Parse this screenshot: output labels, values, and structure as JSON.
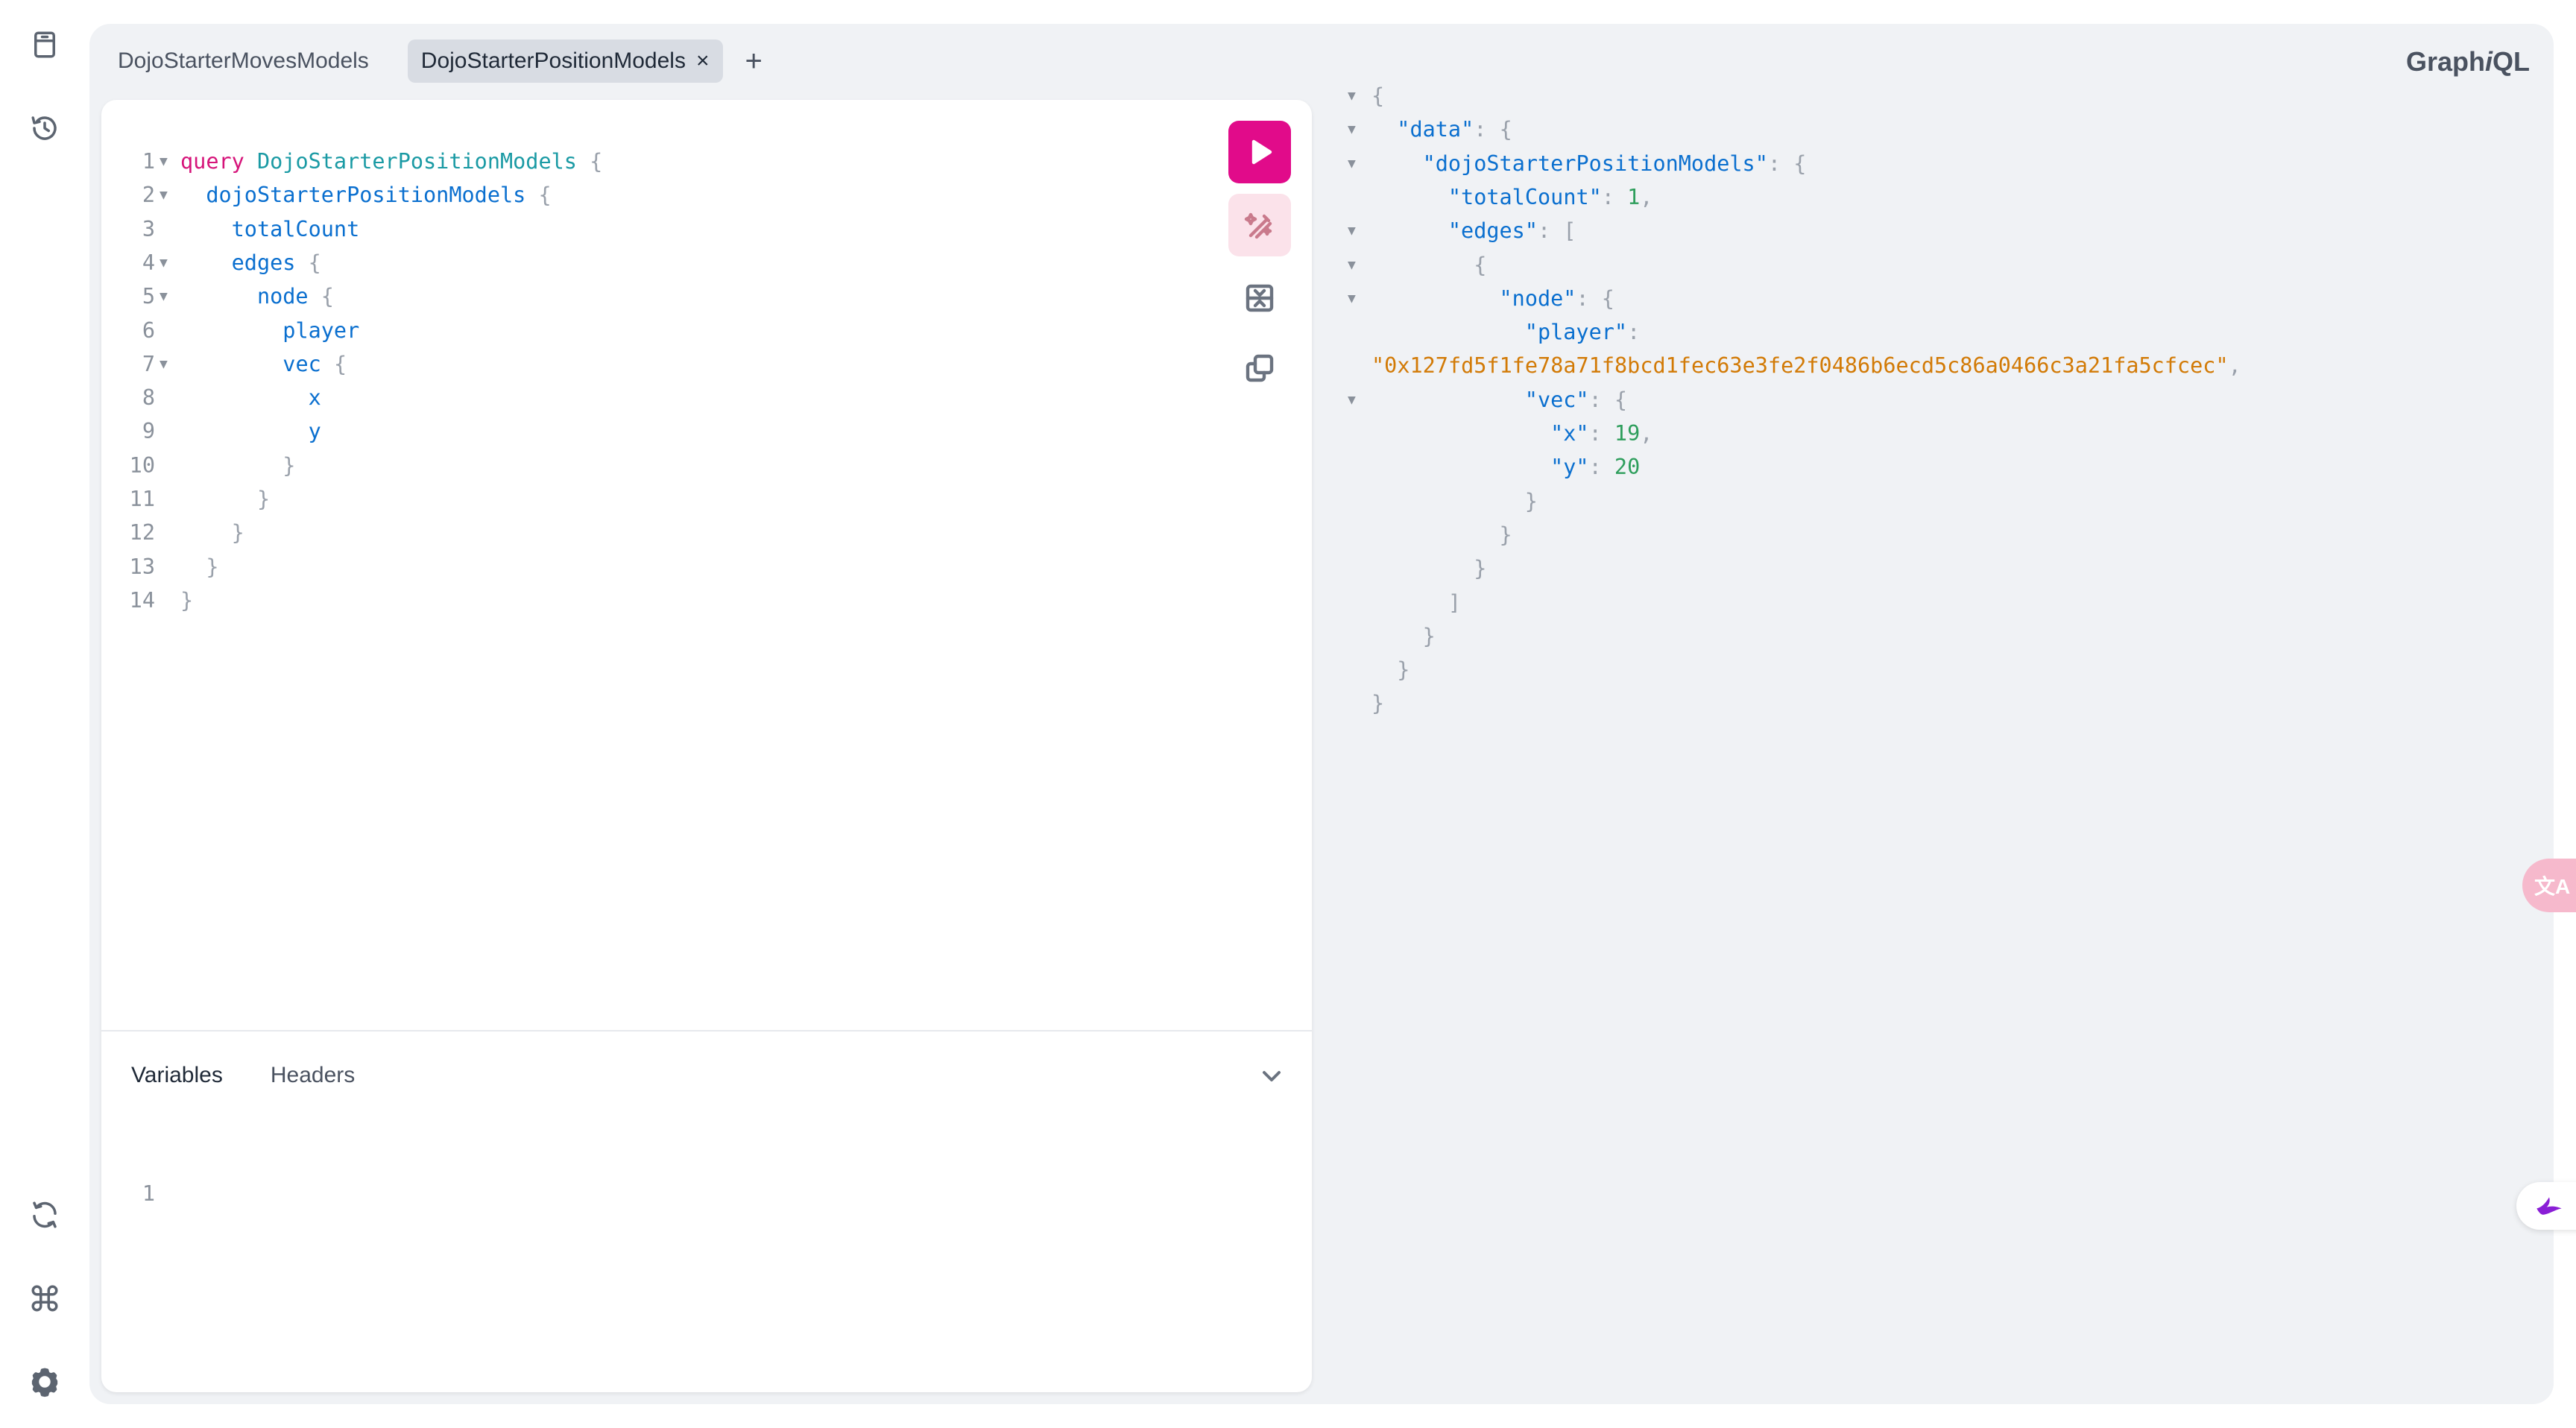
{
  "sidebar": {
    "top_icons": [
      "documentation-icon",
      "history-icon"
    ],
    "bottom_icons": [
      "refetch-schema-icon",
      "keyboard-shortcuts-icon",
      "settings-icon"
    ]
  },
  "tabs": {
    "items": [
      {
        "label": "DojoStarterMovesModels",
        "active": false
      },
      {
        "label": "DojoStarterPositionModels",
        "active": true,
        "close": "×"
      }
    ],
    "add": "+"
  },
  "brand": {
    "prefix": "Graph",
    "italic": "i",
    "suffix": "QL"
  },
  "editor": {
    "lines": [
      {
        "n": "1",
        "fold": true,
        "parts": [
          [
            "kw",
            "query"
          ],
          [
            "plain",
            " "
          ],
          [
            "def",
            "DojoStarterPositionModels"
          ],
          [
            "plain",
            " "
          ],
          [
            "pun",
            "{"
          ]
        ]
      },
      {
        "n": "2",
        "fold": true,
        "parts": [
          [
            "plain",
            "  "
          ],
          [
            "fld",
            "dojoStarterPositionModels"
          ],
          [
            "plain",
            " "
          ],
          [
            "pun",
            "{"
          ]
        ]
      },
      {
        "n": "3",
        "fold": false,
        "parts": [
          [
            "plain",
            "    "
          ],
          [
            "fld",
            "totalCount"
          ]
        ]
      },
      {
        "n": "4",
        "fold": true,
        "parts": [
          [
            "plain",
            "    "
          ],
          [
            "fld",
            "edges"
          ],
          [
            "plain",
            " "
          ],
          [
            "pun",
            "{"
          ]
        ]
      },
      {
        "n": "5",
        "fold": true,
        "parts": [
          [
            "plain",
            "      "
          ],
          [
            "fld",
            "node"
          ],
          [
            "plain",
            " "
          ],
          [
            "pun",
            "{"
          ]
        ]
      },
      {
        "n": "6",
        "fold": false,
        "parts": [
          [
            "plain",
            "        "
          ],
          [
            "fld",
            "player"
          ]
        ]
      },
      {
        "n": "7",
        "fold": true,
        "parts": [
          [
            "plain",
            "        "
          ],
          [
            "fld",
            "vec"
          ],
          [
            "plain",
            " "
          ],
          [
            "pun",
            "{"
          ]
        ]
      },
      {
        "n": "8",
        "fold": false,
        "parts": [
          [
            "plain",
            "          "
          ],
          [
            "fld",
            "x"
          ]
        ]
      },
      {
        "n": "9",
        "fold": false,
        "parts": [
          [
            "plain",
            "          "
          ],
          [
            "fld",
            "y"
          ]
        ]
      },
      {
        "n": "10",
        "fold": false,
        "parts": [
          [
            "plain",
            "        "
          ],
          [
            "pun",
            "}"
          ]
        ]
      },
      {
        "n": "11",
        "fold": false,
        "parts": [
          [
            "plain",
            "      "
          ],
          [
            "pun",
            "}"
          ]
        ]
      },
      {
        "n": "12",
        "fold": false,
        "parts": [
          [
            "plain",
            "    "
          ],
          [
            "pun",
            "}"
          ]
        ]
      },
      {
        "n": "13",
        "fold": false,
        "parts": [
          [
            "plain",
            "  "
          ],
          [
            "pun",
            "}"
          ]
        ]
      },
      {
        "n": "14",
        "fold": false,
        "parts": [
          [
            "pun",
            "}"
          ]
        ]
      }
    ]
  },
  "toolbar": {
    "run": "execute-query-button",
    "prettify": "prettify-button",
    "merge": "merge-fragments-button",
    "copy": "copy-query-button"
  },
  "variables": {
    "tabs": [
      "Variables",
      "Headers"
    ],
    "line_number": "1"
  },
  "result": {
    "lines": [
      {
        "fold": true,
        "indent": 0,
        "parts": [
          [
            "pun",
            "{"
          ]
        ]
      },
      {
        "fold": true,
        "indent": 1,
        "parts": [
          [
            "key",
            "\"data\""
          ],
          [
            "pun",
            ": {"
          ]
        ]
      },
      {
        "fold": true,
        "indent": 2,
        "parts": [
          [
            "key",
            "\"dojoStarterPositionModels\""
          ],
          [
            "pun",
            ": {"
          ]
        ]
      },
      {
        "fold": false,
        "indent": 3,
        "parts": [
          [
            "key",
            "\"totalCount\""
          ],
          [
            "pun",
            ": "
          ],
          [
            "num",
            "1"
          ],
          [
            "pun",
            ","
          ]
        ]
      },
      {
        "fold": true,
        "indent": 3,
        "parts": [
          [
            "key",
            "\"edges\""
          ],
          [
            "pun",
            ": ["
          ]
        ]
      },
      {
        "fold": true,
        "indent": 4,
        "parts": [
          [
            "pun",
            "{"
          ]
        ]
      },
      {
        "fold": true,
        "indent": 5,
        "parts": [
          [
            "key",
            "\"node\""
          ],
          [
            "pun",
            ": {"
          ]
        ]
      },
      {
        "fold": false,
        "indent": 6,
        "parts": [
          [
            "key",
            "\"player\""
          ],
          [
            "pun",
            ":"
          ]
        ]
      },
      {
        "fold": false,
        "indent": 0,
        "parts": [
          [
            "str",
            "\"0x127fd5f1fe78a71f8bcd1fec63e3fe2f0486b6ecd5c86a0466c3a21fa5cfcec\""
          ],
          [
            "pun",
            ","
          ]
        ]
      },
      {
        "fold": true,
        "indent": 6,
        "parts": [
          [
            "key",
            "\"vec\""
          ],
          [
            "pun",
            ": {"
          ]
        ]
      },
      {
        "fold": false,
        "indent": 7,
        "parts": [
          [
            "key",
            "\"x\""
          ],
          [
            "pun",
            ": "
          ],
          [
            "num",
            "19"
          ],
          [
            "pun",
            ","
          ]
        ]
      },
      {
        "fold": false,
        "indent": 7,
        "parts": [
          [
            "key",
            "\"y\""
          ],
          [
            "pun",
            ": "
          ],
          [
            "num",
            "20"
          ]
        ]
      },
      {
        "fold": false,
        "indent": 6,
        "parts": [
          [
            "pun",
            "}"
          ]
        ]
      },
      {
        "fold": false,
        "indent": 5,
        "parts": [
          [
            "pun",
            "}"
          ]
        ]
      },
      {
        "fold": false,
        "indent": 4,
        "parts": [
          [
            "pun",
            "}"
          ]
        ]
      },
      {
        "fold": false,
        "indent": 3,
        "parts": [
          [
            "pun",
            "]"
          ]
        ]
      },
      {
        "fold": false,
        "indent": 2,
        "parts": [
          [
            "pun",
            "}"
          ]
        ]
      },
      {
        "fold": false,
        "indent": 1,
        "parts": [
          [
            "pun",
            "}"
          ]
        ]
      },
      {
        "fold": false,
        "indent": 0,
        "parts": [
          [
            "pun",
            "}"
          ]
        ]
      }
    ]
  },
  "floating": {
    "translate_label": "文A",
    "extension": "extension-bird-icon"
  },
  "colors": {
    "accent": "#e10b8a",
    "keyword": "#d6147a",
    "definition": "#1a9aa4",
    "field": "#0a6fcf",
    "number": "#2e9e5c",
    "string": "#d27a06",
    "punctuation": "#9aa1ab"
  }
}
